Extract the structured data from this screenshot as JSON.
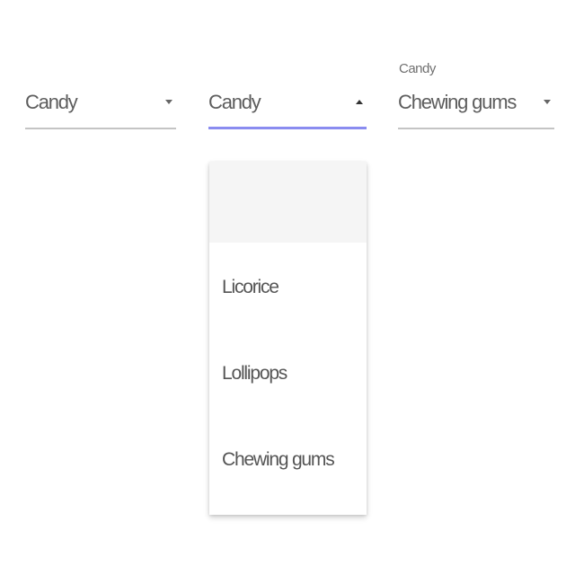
{
  "selects": [
    {
      "floating_label": "",
      "value": "Candy",
      "state": "closed"
    },
    {
      "floating_label": "",
      "value": "Candy",
      "state": "open",
      "accent_color": "#8a8cf0"
    },
    {
      "floating_label": "Candy",
      "value": "Chewing gums",
      "state": "closed"
    }
  ],
  "menu": {
    "options": [
      "Licorice",
      "Lollipops",
      "Chewing gums"
    ]
  },
  "colors": {
    "underline": "#c4c4c4",
    "focused_underline": "#8a8cf0",
    "menu_highlight": "#f5f5f5"
  }
}
